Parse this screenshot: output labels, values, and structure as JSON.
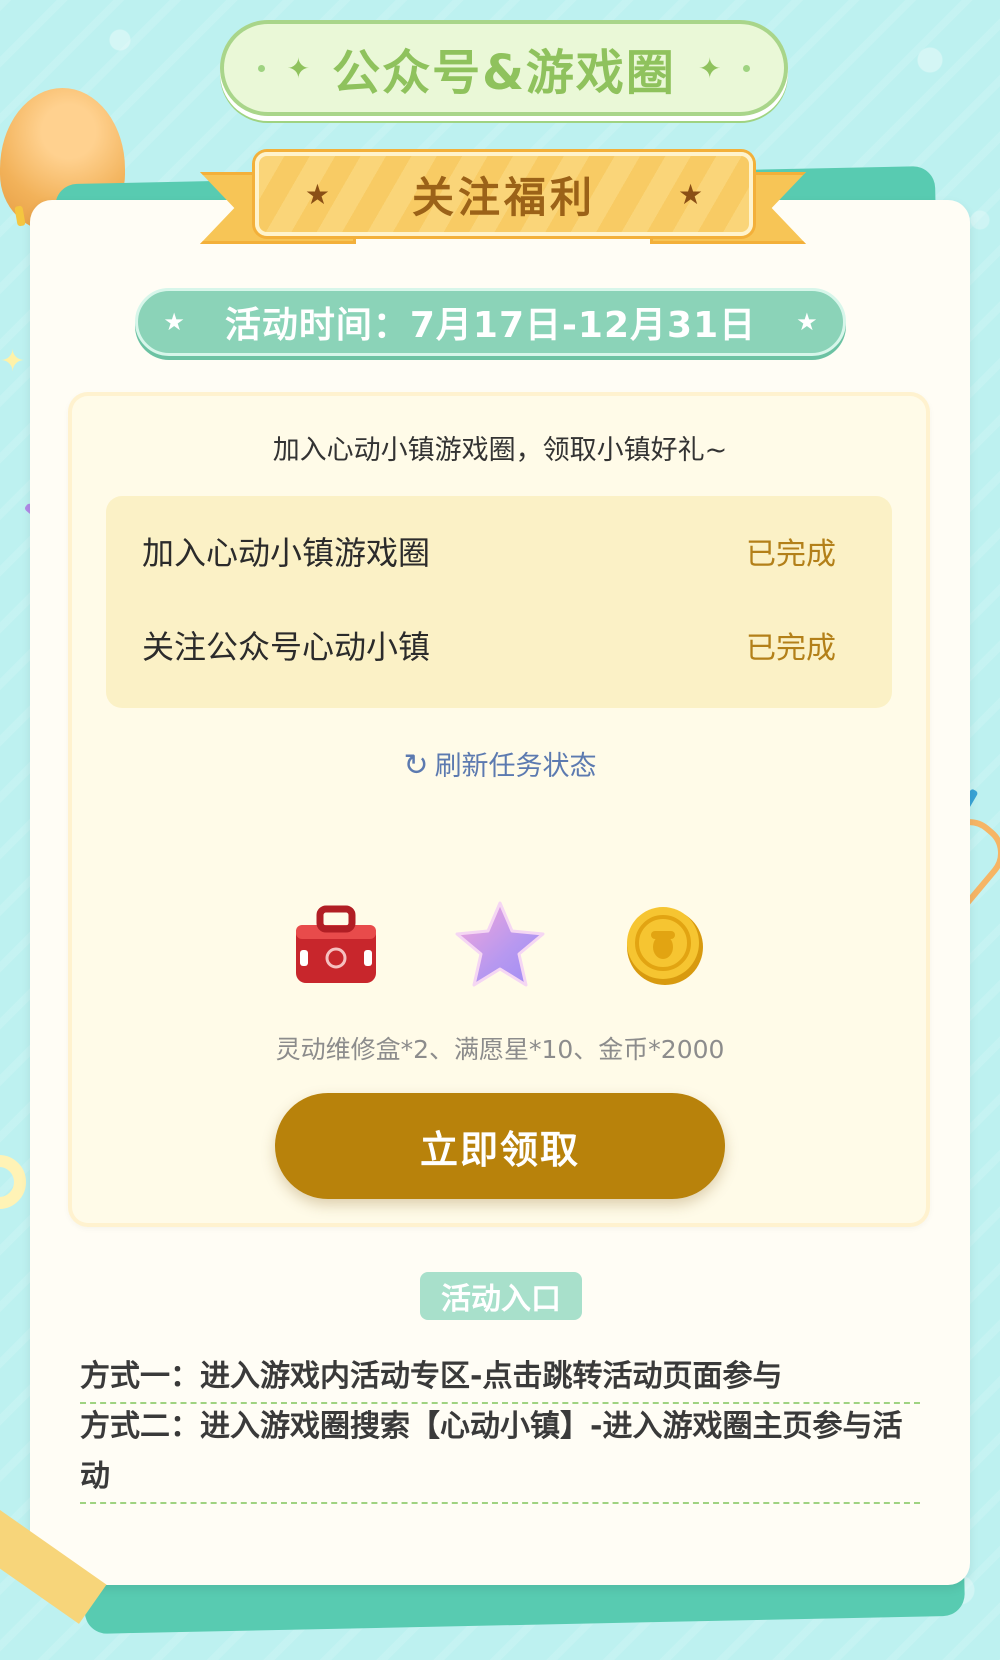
{
  "header": {
    "title": "公众号&游戏圈",
    "ribbon_label": "关注福利",
    "activity_time": "活动时间：7月17日-12月31日"
  },
  "panel": {
    "intro": "加入心动小镇游戏圈，领取小镇好礼~",
    "tasks": [
      {
        "name": "加入心动小镇游戏圈",
        "status": "已完成"
      },
      {
        "name": "关注公众号心动小镇",
        "status": "已完成"
      }
    ],
    "refresh_label": "刷新任务状态",
    "rewards": [
      {
        "icon": "toolbox-icon"
      },
      {
        "icon": "star-icon"
      },
      {
        "icon": "coin-icon"
      }
    ],
    "reward_text": "灵动维修盒*2、满愿星*10、金币*2000",
    "claim_button": "立即领取"
  },
  "entrance": {
    "tag": "活动入口",
    "methods": [
      "方式一：进入游戏内活动专区-点击跳转活动页面参与",
      "方式二：进入游戏圈搜索【心动小镇】-进入游戏圈主页参与活动"
    ]
  },
  "colors": {
    "background": "#bdf1f0",
    "accent_green": "#8fc25d",
    "teal": "#8bd3b8",
    "gold": "#b8820b",
    "task_bg": "#fbf1c6",
    "status": "#b38019",
    "refresh": "#5c7ab0"
  }
}
